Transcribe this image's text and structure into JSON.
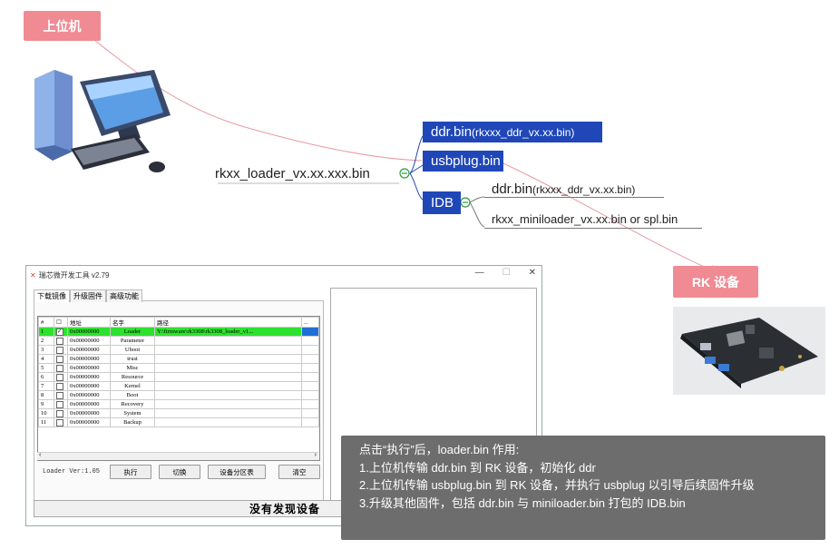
{
  "tags": {
    "host": "上位机",
    "device": "RK 设备"
  },
  "mind_map": {
    "root": "rkxx_loader_vx.xx.xxx.bin",
    "ddr_main": "ddr.bin",
    "ddr_main_sub": "(rkxxx_ddr_vx.xx.bin)",
    "usbplug": "usbplug.bin",
    "idb": "IDB",
    "idb_ddr": "ddr.bin",
    "idb_ddr_sub": "(rkxxx_ddr_vx.xx.bin)",
    "idb_miniloader": "rkxx_miniloader_vx.xx.bin or spl.bin"
  },
  "tool": {
    "title": "瑞芯微开发工具 v2.79",
    "window_controls": [
      "—",
      "☐",
      "✕"
    ],
    "tabs": [
      "下载镜像",
      "升级固件",
      "高级功能"
    ],
    "columns": [
      "#",
      "☐",
      "地址",
      "名字",
      "路径",
      "..."
    ],
    "rows": [
      {
        "n": "1",
        "checked": true,
        "addr": "0x00000000",
        "name": "Loader",
        "path": "Y:\\firmware\\rk3308\\rk3308_loader_v1..."
      },
      {
        "n": "2",
        "checked": false,
        "addr": "0x00000000",
        "name": "Parameter",
        "path": ""
      },
      {
        "n": "3",
        "checked": false,
        "addr": "0x00000000",
        "name": "Uboot",
        "path": ""
      },
      {
        "n": "4",
        "checked": false,
        "addr": "0x00000000",
        "name": "trust",
        "path": ""
      },
      {
        "n": "5",
        "checked": false,
        "addr": "0x00000000",
        "name": "Misc",
        "path": ""
      },
      {
        "n": "6",
        "checked": false,
        "addr": "0x00000000",
        "name": "Resource",
        "path": ""
      },
      {
        "n": "7",
        "checked": false,
        "addr": "0x00000000",
        "name": "Kernel",
        "path": ""
      },
      {
        "n": "8",
        "checked": false,
        "addr": "0x00000000",
        "name": "Boot",
        "path": ""
      },
      {
        "n": "9",
        "checked": false,
        "addr": "0x00000000",
        "name": "Recovery",
        "path": ""
      },
      {
        "n": "10",
        "checked": false,
        "addr": "0x00000000",
        "name": "System",
        "path": ""
      },
      {
        "n": "11",
        "checked": false,
        "addr": "0x00000000",
        "name": "Backup",
        "path": ""
      }
    ],
    "loader_ver": "Loader Ver:1.05",
    "buttons": {
      "run": "执行",
      "switch": "切换",
      "partition": "设备分区表",
      "clear": "清空"
    },
    "status": "没有发现设备"
  },
  "note": {
    "lines": [
      "点击“执行”后，loader.bin 作用:",
      "1.上位机传输 ddr.bin 到 RK 设备，初始化 ddr",
      "2.上位机传输 usbplug.bin 到 RK 设备，并执行 usbplug 以引导后续固件升级",
      "3.升级其他固件，包括 ddr.bin 与 miniloader.bin 打包的 IDB.bin"
    ]
  },
  "colors": {
    "tag": "#f08a93",
    "node_blue": "#1f47b8",
    "connector_green": "#2a9d3a",
    "highlight_row": "#2ee12e",
    "note_bg": "#6d6d6d"
  },
  "icons": [
    "desktop-computer-icon",
    "rk-board-photo"
  ]
}
